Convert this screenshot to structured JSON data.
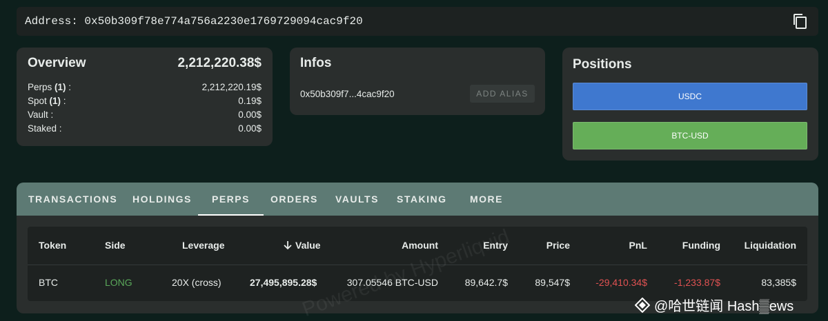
{
  "address_bar": {
    "label": "Address: 0x50b309f78e774a756a2230e1769729094cac9f20"
  },
  "overview": {
    "title": "Overview",
    "total": "2,212,220.38$",
    "rows": [
      {
        "label": "Perps",
        "count": "(1)",
        "suffix": " :",
        "value": "2,212,220.19$"
      },
      {
        "label": "Spot",
        "count": "(1)",
        "suffix": " :",
        "value": "0.19$"
      },
      {
        "label": "Vault :",
        "count": "",
        "suffix": "",
        "value": "0.00$"
      },
      {
        "label": "Staked :",
        "count": "",
        "suffix": "",
        "value": "0.00$"
      }
    ]
  },
  "infos": {
    "title": "Infos",
    "short_address": "0x50b309f7...4cac9f20",
    "add_alias_label": "ADD ALIAS"
  },
  "positions": {
    "title": "Positions",
    "items": [
      {
        "label": "USDC",
        "color": "#3f78cf"
      },
      {
        "label": "BTC-USD",
        "color": "#65ae58"
      }
    ]
  },
  "tabs": [
    {
      "label": "TRANSACTIONS",
      "active": false
    },
    {
      "label": "HOLDINGS",
      "active": false
    },
    {
      "label": "PERPS",
      "active": true
    },
    {
      "label": "ORDERS",
      "active": false
    },
    {
      "label": "VAULTS",
      "active": false
    },
    {
      "label": "STAKING",
      "active": false
    },
    {
      "label": "MORE",
      "active": false
    }
  ],
  "table": {
    "columns": [
      "Token",
      "Side",
      "Leverage",
      "Value",
      "Amount",
      "Entry",
      "Price",
      "PnL",
      "Funding",
      "Liquidation"
    ],
    "sort_icon": "arrow-down-icon",
    "rows": [
      {
        "token": "BTC",
        "side": "LONG",
        "leverage": "20X (cross)",
        "value": "27,495,895.28$",
        "amount": "307.05546 BTC-USD",
        "entry": "89,642.7$",
        "price": "89,547$",
        "pnl": "-29,410.34$",
        "funding": "-1,233.87$",
        "liquidation": "83,385$"
      }
    ]
  },
  "colors": {
    "long": "#5aa85a",
    "negative": "#e05252",
    "tab_bar": "#5d7a74"
  },
  "watermark": "Powered by Hyperliquid",
  "footer_brand": "@哈世链闻 Hash▒ews"
}
